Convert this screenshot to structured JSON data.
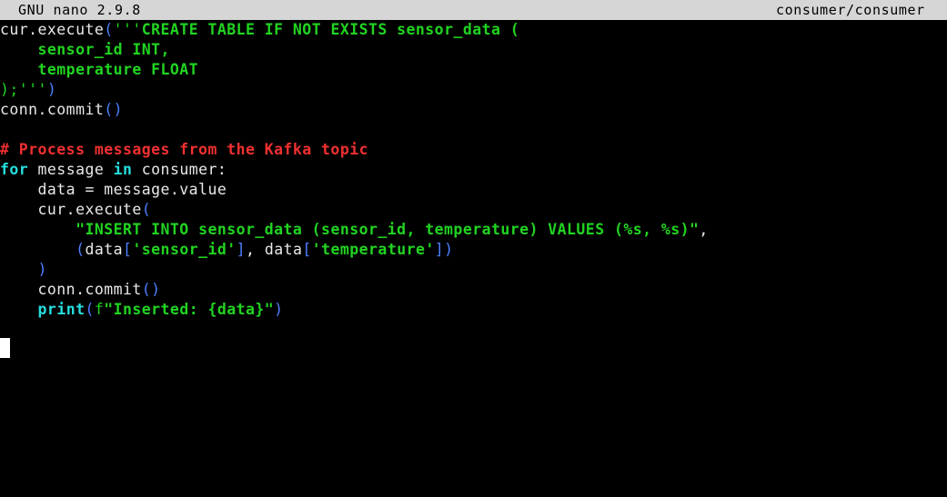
{
  "app": {
    "name": "GNU nano",
    "version_label": "GNU nano 2.9.8",
    "filename_label": "consumer/consumer"
  },
  "editor": {
    "cursor": {
      "line": 17,
      "column": 1,
      "visible": true
    },
    "colors": {
      "background": "#000000",
      "titlebar_background": "#d6d6d6",
      "titlebar_foreground": "#000000",
      "default_text": "#e9e9e9",
      "string": "#21d421",
      "comment": "#f03030",
      "keyword": "#25dede",
      "bracket": "#4d7fff",
      "cursor": "#ffffff"
    },
    "lines": [
      {
        "id": "line-1",
        "tokens": [
          {
            "text": "cur.execute",
            "kind": "plain"
          },
          {
            "text": "(",
            "kind": "paren"
          },
          {
            "text": "'''",
            "kind": "strq"
          },
          {
            "text": "CREATE TABLE IF NOT EXISTS sensor_data (",
            "kind": "str"
          }
        ]
      },
      {
        "id": "line-2",
        "tokens": [
          {
            "text": "    sensor_id INT,",
            "kind": "str"
          }
        ]
      },
      {
        "id": "line-3",
        "tokens": [
          {
            "text": "    temperature FLOAT",
            "kind": "str"
          }
        ]
      },
      {
        "id": "line-4",
        "tokens": [
          {
            "text": ");'''",
            "kind": "strq"
          },
          {
            "text": ")",
            "kind": "paren"
          }
        ]
      },
      {
        "id": "line-5",
        "tokens": [
          {
            "text": "conn.commit",
            "kind": "plain"
          },
          {
            "text": "()",
            "kind": "paren"
          }
        ]
      },
      {
        "id": "line-6",
        "tokens": [
          {
            "text": "",
            "kind": "plain"
          }
        ]
      },
      {
        "id": "line-7",
        "tokens": [
          {
            "text": "# Process messages from the Kafka topic",
            "kind": "cmt"
          }
        ]
      },
      {
        "id": "line-8",
        "tokens": [
          {
            "text": "for",
            "kind": "kw"
          },
          {
            "text": " message ",
            "kind": "plain"
          },
          {
            "text": "in",
            "kind": "kw"
          },
          {
            "text": " consumer:",
            "kind": "plain"
          }
        ]
      },
      {
        "id": "line-9",
        "tokens": [
          {
            "text": "    data = message.value",
            "kind": "plain"
          }
        ]
      },
      {
        "id": "line-10",
        "tokens": [
          {
            "text": "    cur.execute",
            "kind": "plain"
          },
          {
            "text": "(",
            "kind": "paren"
          }
        ]
      },
      {
        "id": "line-11",
        "tokens": [
          {
            "text": "        ",
            "kind": "plain"
          },
          {
            "text": "\"INSERT INTO sensor_data (sensor_id, temperature) VALUES (%s, %s)\"",
            "kind": "str"
          },
          {
            "text": ",",
            "kind": "plain"
          }
        ]
      },
      {
        "id": "line-12",
        "tokens": [
          {
            "text": "        ",
            "kind": "plain"
          },
          {
            "text": "(",
            "kind": "paren"
          },
          {
            "text": "data",
            "kind": "plain"
          },
          {
            "text": "[",
            "kind": "paren"
          },
          {
            "text": "'sensor_id'",
            "kind": "str"
          },
          {
            "text": "]",
            "kind": "paren"
          },
          {
            "text": ", ",
            "kind": "plain"
          },
          {
            "text": "data",
            "kind": "plain"
          },
          {
            "text": "[",
            "kind": "paren"
          },
          {
            "text": "'temperature'",
            "kind": "str"
          },
          {
            "text": "])",
            "kind": "paren"
          }
        ]
      },
      {
        "id": "line-13",
        "tokens": [
          {
            "text": "    ",
            "kind": "plain"
          },
          {
            "text": ")",
            "kind": "paren"
          }
        ]
      },
      {
        "id": "line-14",
        "tokens": [
          {
            "text": "    conn.commit",
            "kind": "plain"
          },
          {
            "text": "()",
            "kind": "paren"
          }
        ]
      },
      {
        "id": "line-15",
        "tokens": [
          {
            "text": "    ",
            "kind": "plain"
          },
          {
            "text": "print",
            "kind": "kw"
          },
          {
            "text": "(",
            "kind": "paren"
          },
          {
            "text": "f",
            "kind": "fpref"
          },
          {
            "text": "\"Inserted: {data}\"",
            "kind": "str"
          },
          {
            "text": ")",
            "kind": "paren"
          }
        ]
      },
      {
        "id": "line-16",
        "tokens": [
          {
            "text": "",
            "kind": "plain"
          }
        ]
      },
      {
        "id": "line-17",
        "tokens": [
          {
            "text": "",
            "kind": "plain"
          }
        ]
      }
    ]
  }
}
